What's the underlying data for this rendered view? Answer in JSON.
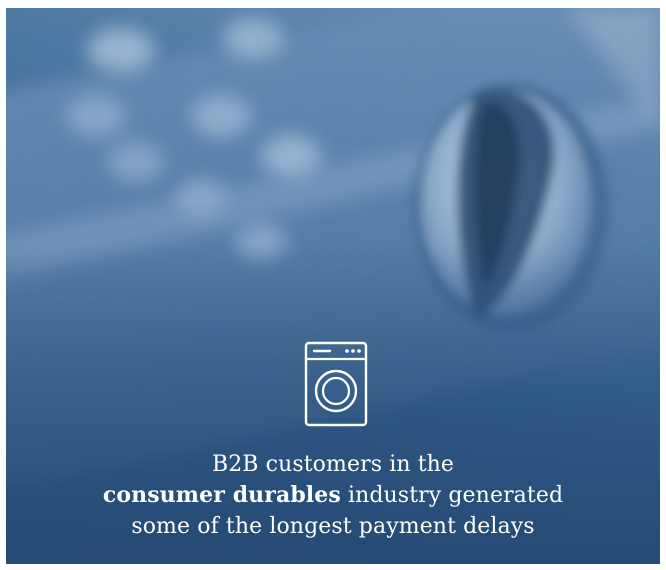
{
  "icon": "washing-machine-icon",
  "caption": {
    "line1": "B2B customers in the",
    "line2_bold": "consumer durables",
    "line2_rest": " industry generated",
    "line3": "some of the longest payment delays"
  },
  "colors": {
    "background": "#3a6594",
    "text": "#ffffff"
  }
}
